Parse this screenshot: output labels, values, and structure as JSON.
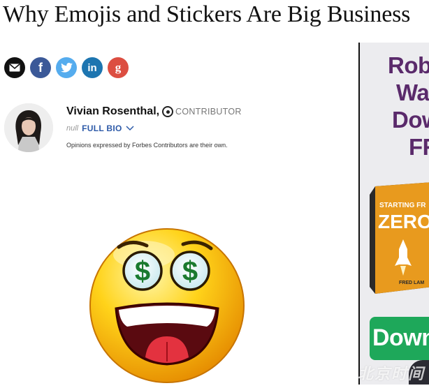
{
  "article": {
    "headline": "Why Emojis and Stickers Are Big Business",
    "author": {
      "name": "Vivian Rosenthal,",
      "role": "CONTRIBUTOR",
      "bio_prefix": "null",
      "bio_link": "FULL BIO"
    },
    "disclaimer": "Opinions expressed by Forbes Contributors are their own."
  },
  "share": {
    "icons": [
      "email-icon",
      "facebook-icon",
      "twitter-icon",
      "linkedin-icon",
      "google-plus-icon"
    ],
    "glyphs": [
      "✉",
      "f",
      "t",
      "in",
      "g"
    ]
  },
  "ad": {
    "lines": [
      "Robe",
      "War",
      "Dow",
      "FR"
    ],
    "book_tag": "STARTING FR",
    "book_title": "ZERO",
    "book_author": "FRED LAM",
    "cta": "Down",
    "colors": {
      "headline": "#5a2a6b",
      "cta": "#1ea85a",
      "book": "#e89a1e"
    }
  },
  "watermark": "北京时间",
  "emoji": {
    "name": "money-eyes-emoji",
    "eye_symbol": "$"
  }
}
